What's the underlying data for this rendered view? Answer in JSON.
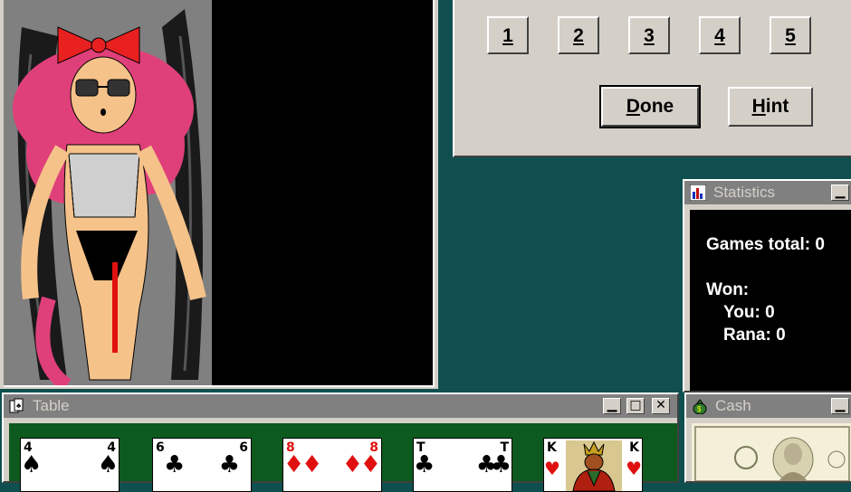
{
  "buttons_panel": {
    "numbers": [
      "1",
      "2",
      "3",
      "4",
      "5"
    ],
    "done": {
      "underline": "D",
      "rest": "one"
    },
    "hint": {
      "underline": "H",
      "rest": "int"
    }
  },
  "statistics": {
    "title": "Statistics",
    "games_total": "Games total: 0",
    "won": "Won:",
    "you": "You: 0",
    "rana": "Rana: 0"
  },
  "table": {
    "title": "Table",
    "cards": [
      {
        "rank": "4",
        "suit": "♠",
        "color": "#000000"
      },
      {
        "rank": "6",
        "suit": "♣",
        "color": "#000000"
      },
      {
        "rank": "8",
        "suit": "♦",
        "color": "#e01010"
      },
      {
        "rank": "T",
        "suit": "♣",
        "color": "#000000"
      },
      {
        "rank": "K",
        "suit": "♥",
        "color": "#e01010"
      }
    ]
  },
  "cash": {
    "title": "Cash"
  },
  "colors": {
    "desktop": "#0f4f4f",
    "face": "#d4d0c8",
    "felt": "#0d5a1e",
    "title_inactive": "#808080"
  },
  "icons": {
    "minimize": "▁",
    "maximize": "□",
    "close": "✕"
  }
}
